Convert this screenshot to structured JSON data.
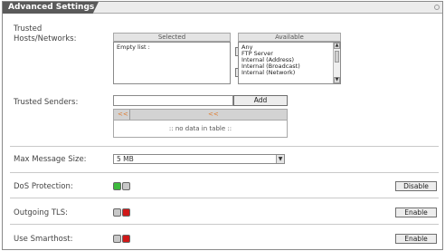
{
  "title": "Advanced Settings",
  "colors": {
    "accent_on": "#3dbb3d",
    "accent_off": "#d01818",
    "neutral": "#c8c8c8",
    "empty_marker": "#e07a2a"
  },
  "trusted_hosts": {
    "label_line1": "Trusted",
    "label_line2": "Hosts/Networks:",
    "selected_header": "Selected",
    "available_header": "Available",
    "selected_items": [
      "Empty list :"
    ],
    "available_items": [
      "Any",
      "FTP Server",
      "Internal (Address)",
      "Internal (Broadcast)",
      "Internal (Network)"
    ],
    "move_left_glyph": "◄",
    "move_right_glyph": "►"
  },
  "trusted_senders": {
    "label": "Trusted Senders:",
    "input_value": "",
    "add_label": "Add",
    "col_marker_1": "<<",
    "col_marker_2": "<<",
    "empty_text": ":: no data in table ::"
  },
  "max_message_size": {
    "label": "Max Message Size:",
    "selected_value": "5 MB"
  },
  "dos_protection": {
    "label": "DoS Protection:",
    "state": "on",
    "button_label": "Disable"
  },
  "outgoing_tls": {
    "label": "Outgoing TLS:",
    "state": "off",
    "button_label": "Enable"
  },
  "use_smarthost": {
    "label": "Use Smarthost:",
    "state": "off",
    "button_label": "Enable"
  }
}
